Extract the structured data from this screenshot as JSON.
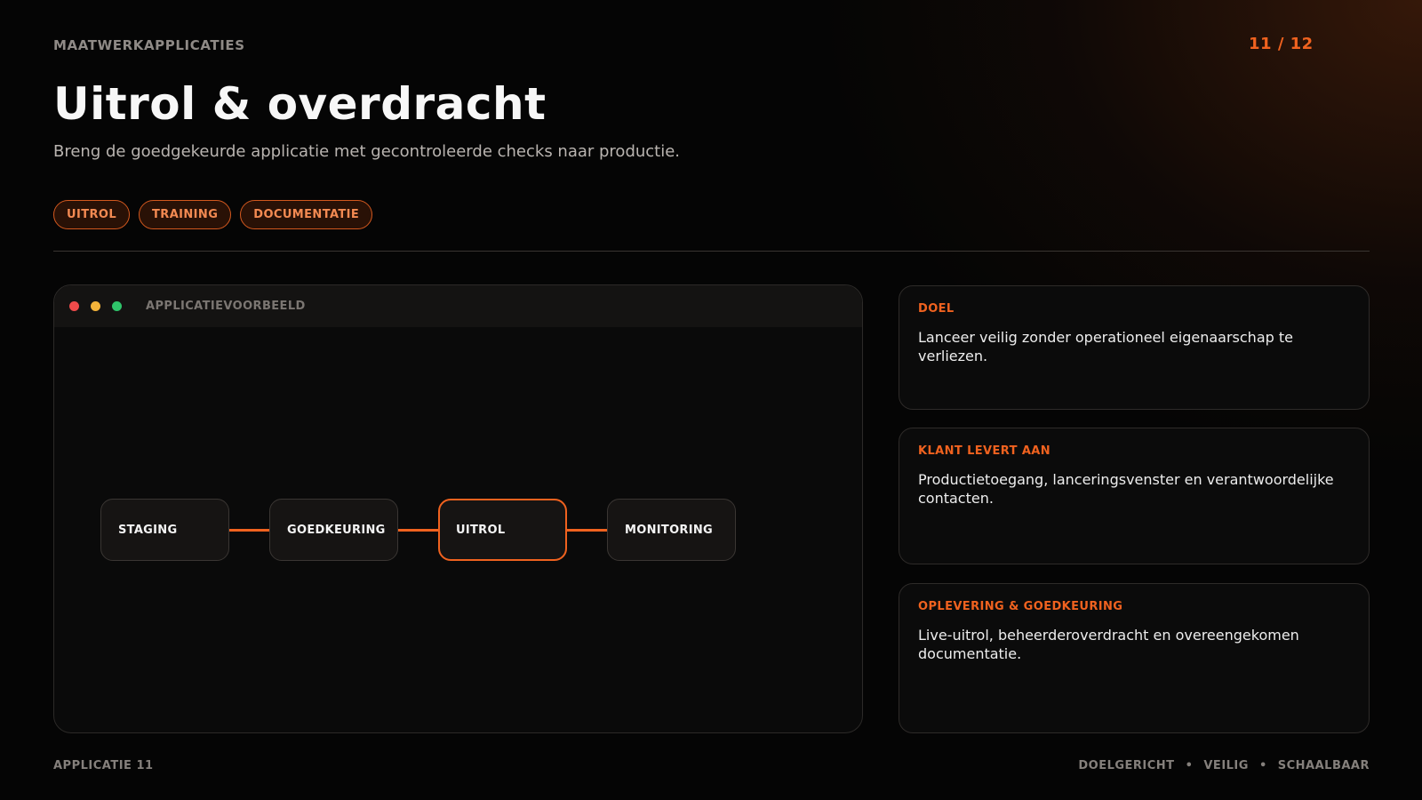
{
  "header": {
    "eyebrow": "MAATWERKAPPLICATIES",
    "page_counter": "11 / 12",
    "title": "Uitrol & overdracht",
    "subtitle": "Breng de goedgekeurde applicatie met gecontroleerde checks naar productie."
  },
  "tags": [
    "UITROL",
    "TRAINING",
    "DOCUMENTATIE"
  ],
  "preview": {
    "label": "APPLICATIEVOORBEELD",
    "steps": [
      {
        "label": "STAGING",
        "active": false
      },
      {
        "label": "GOEDKEURING",
        "active": false
      },
      {
        "label": "UITROL",
        "active": true
      },
      {
        "label": "MONITORING",
        "active": false
      }
    ]
  },
  "cards": [
    {
      "heading": "DOEL",
      "text": "Lanceer veilig zonder operationeel eigenaarschap te verliezen."
    },
    {
      "heading": "KLANT LEVERT AAN",
      "text": "Productietoegang, lanceringsvenster en verantwoordelijke contacten."
    },
    {
      "heading": "OPLEVERING & GOEDKEURING",
      "text": "Live-uitrol, beheerderoverdracht en overeengekomen documentatie."
    }
  ],
  "footer": {
    "left": "APPLICATIE 11",
    "right_items": [
      "DOELGERICHT",
      "VEILIG",
      "SCHAALBAAR"
    ],
    "separator": "•"
  },
  "colors": {
    "accent": "#f0621f",
    "background": "#050505",
    "card_background": "#0b0b0b"
  }
}
